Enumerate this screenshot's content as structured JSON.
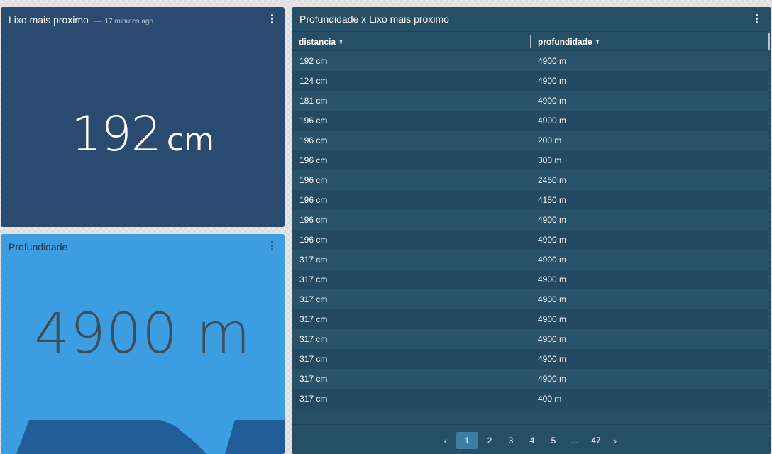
{
  "nearest_card": {
    "title": "Lixo mais proximo",
    "separator": "—",
    "updated": "17 minutes ago",
    "value": "192",
    "unit": "cm"
  },
  "depth_card": {
    "title": "Profundidade",
    "value": "4900 m"
  },
  "table_card": {
    "title": "Profundidade x Lixo mais proximo",
    "columns": [
      "distancia",
      "profundidade"
    ],
    "sort_icon": "⬍",
    "rows": [
      [
        "192 cm",
        "4900 m"
      ],
      [
        "124 cm",
        "4900 m"
      ],
      [
        "181 cm",
        "4900 m"
      ],
      [
        "196 cm",
        "4900 m"
      ],
      [
        "196 cm",
        "200 m"
      ],
      [
        "196 cm",
        "300 m"
      ],
      [
        "196 cm",
        "2450 m"
      ],
      [
        "196 cm",
        "4150 m"
      ],
      [
        "196 cm",
        "4900 m"
      ],
      [
        "196 cm",
        "4900 m"
      ],
      [
        "317 cm",
        "4900 m"
      ],
      [
        "317 cm",
        "4900 m"
      ],
      [
        "317 cm",
        "4900 m"
      ],
      [
        "317 cm",
        "4900 m"
      ],
      [
        "317 cm",
        "4900 m"
      ],
      [
        "317 cm",
        "4900 m"
      ],
      [
        "317 cm",
        "4900 m"
      ],
      [
        "317 cm",
        "400 m"
      ]
    ],
    "pagination": {
      "prev": "‹",
      "pages": [
        "1",
        "2",
        "3",
        "4",
        "5",
        "...",
        "47"
      ],
      "next": "›",
      "active_page": "1"
    }
  },
  "colors": {
    "nearest_bg": "#2b4a6f",
    "depth_bg": "#3c9ee0",
    "depth_wave": "#215d99",
    "table_bg": "#264f66",
    "active_page": "#3d7ea6"
  }
}
